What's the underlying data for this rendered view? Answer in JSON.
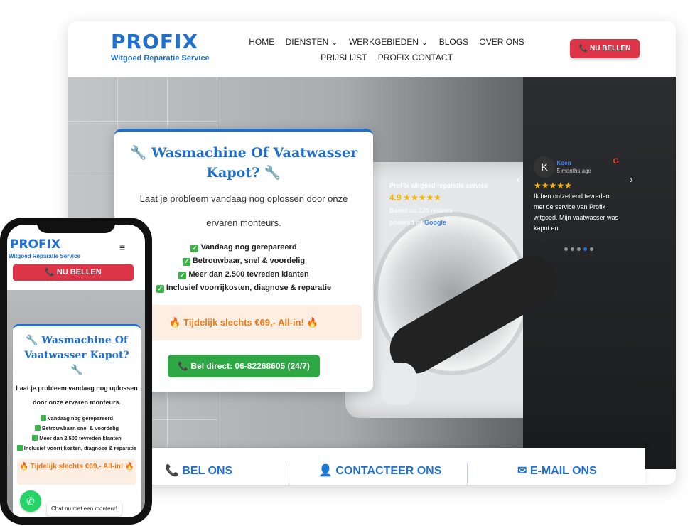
{
  "brand": {
    "name": "PROFIX",
    "tagline": "Witgoed Reparatie Service",
    "color": "#1f6fd1"
  },
  "nav": {
    "items": [
      "HOME",
      "DIENSTEN ⌄",
      "WERKGEBIEDEN ⌄",
      "BLOGS",
      "OVER ONS",
      "PRIJSLIJST",
      "PROFIX CONTACT"
    ]
  },
  "header_cta": "📞 NU BELLEN",
  "hero": {
    "title": "🔧 Wasmachine Of Vaatwasser Kapot? 🔧",
    "subtitle_1": "Laat je probleem vandaag nog oplossen door onze",
    "subtitle_2": "ervaren monteurs.",
    "checks": [
      "Vandaag nog gerepareerd",
      "Betrouwbaar, snel & voordelig",
      "Meer dan 2.500 tevreden klanten",
      "Inclusief voorrijkosten, diagnose & reparatie"
    ],
    "promo": "🔥 Tijdelijk slechts €69,- All-in! 🔥",
    "call_button": "📞 Bel direct: 06-82268605 (24/7)"
  },
  "reviews": {
    "business": "ProFix witgoed reparatie service",
    "rating": "4.9",
    "stars": "★★★★★",
    "count_text": "Based on 224 reviews",
    "powered": "powered by",
    "powered_brand": "Google",
    "reviewer_initial": "K",
    "reviewer_name": "Koen",
    "review_age": "5 months ago",
    "review_text": "Ik ben ontzettend tevreden met de service van Profix witgoed. Mijn vaatwasser was kapot en"
  },
  "strip": {
    "bel": "📞 BEL ONS",
    "contact": "👤 CONTACTEER ONS",
    "email": "✉ E-MAIL ONS"
  },
  "mobile": {
    "brand": "PROFIX",
    "tagline": "Witgoed Reparatie Service",
    "cta": "📞 NU BELLEN",
    "title": "🔧 Wasmachine Of Vaatwasser Kapot? 🔧",
    "subtitle": "Laat je probleem vandaag nog oplossen door onze ervaren monteurs.",
    "checks": [
      "Vandaag nog gerepareerd",
      "Betrouwbaar, snel & voordelig",
      "Meer dan 2.500 tevreden klanten",
      "Inclusief voorrijkosten, diagnose & reparatie"
    ],
    "promo": "🔥 Tijdelijk slechts €69,- All-in! 🔥",
    "chat": "Chat nu met een monteur!"
  }
}
